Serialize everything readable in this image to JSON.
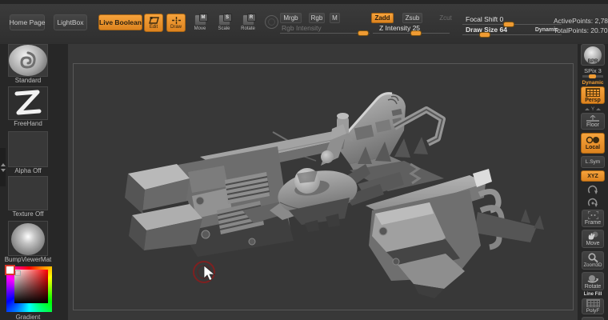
{
  "colors": {
    "accent": "#e78b2b",
    "canvas_bg": "#383838",
    "chrome_bg": "#2f2f2f"
  },
  "toolbar": {
    "home_page": "Home Page",
    "lightbox": "LightBox",
    "live_boolean": "Live Boolean",
    "edit": "Edit",
    "draw": "Draw",
    "move": "Move",
    "scale": "Scale",
    "rotate": "Rotate",
    "move_badge": "M",
    "scale_badge": "S",
    "rotate_badge": "R",
    "mrgb": "Mrgb",
    "rgb": "Rgb",
    "m": "M",
    "zadd": "Zadd",
    "zsub": "Zsub",
    "zcut": "Zcut",
    "rgb_intensity": "Rgb Intensity",
    "z_intensity": "Z Intensity 25",
    "focal_shift": "Focal Shift 0",
    "draw_size": "Draw Size 64",
    "dynamic": "Dynamic",
    "active_points": "ActivePoints: 2,78",
    "total_points": "TotalPoints: 20.70"
  },
  "left_shelf": {
    "items": [
      {
        "label": "Standard"
      },
      {
        "label": "FreeHand"
      },
      {
        "label": "Alpha Off"
      },
      {
        "label": "Texture Off"
      },
      {
        "label": "BumpViewerMat"
      },
      {
        "label": "Gradient"
      }
    ]
  },
  "right_shelf": {
    "bpr": "BPR",
    "spix": "SPix 3",
    "dynamic": "Dynamic",
    "persp": "Persp",
    "floor_axis": "Y",
    "floor": "Floor",
    "local": "Local",
    "lsym": "L.Sym",
    "xyz": "XYZ",
    "frame": "Frame",
    "move": "Move",
    "zoom3d": "Zoom3D",
    "rotate": "Rotate",
    "line_fill": "Line Fill",
    "polyf": "PolyF"
  }
}
